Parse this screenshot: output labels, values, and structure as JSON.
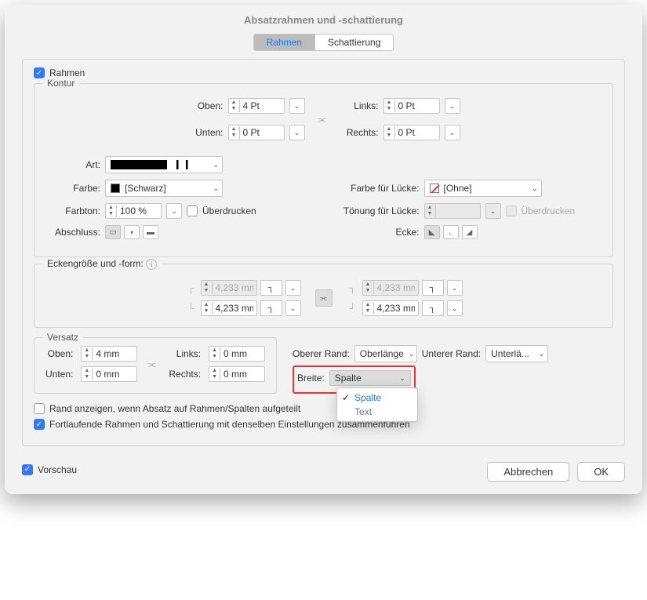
{
  "title": "Absatzrahmen und -schattierung",
  "tabs": {
    "rahmen": "Rahmen",
    "schattierung": "Schattierung"
  },
  "rahmen_chk": "Rahmen",
  "kontur": {
    "legend": "Kontur",
    "oben_l": "Oben:",
    "oben_v": "4 Pt",
    "unten_l": "Unten:",
    "unten_v": "0 Pt",
    "links_l": "Links:",
    "links_v": "0 Pt",
    "rechts_l": "Rechts:",
    "rechts_v": "0 Pt"
  },
  "art_l": "Art:",
  "farbe_l": "Farbe:",
  "farbe_v": "[Schwarz]",
  "farbton_l": "Farbton:",
  "farbton_v": "100 %",
  "ueberdrucken": "Überdrucken",
  "abschluss_l": "Abschluss:",
  "luecke_farbe_l": "Farbe für Lücke:",
  "luecke_farbe_v": "[Ohne]",
  "luecke_ton_l": "Tönung für Lücke:",
  "ecke_l": "Ecke:",
  "ecken_legend": "Eckengröße und -form:",
  "corner_v": "4,233 mm",
  "versatz": {
    "legend": "Versatz",
    "oben_l": "Oben:",
    "oben_v": "4 mm",
    "unten_l": "Unten:",
    "unten_v": "0 mm",
    "links_l": "Links:",
    "links_v": "0 mm",
    "rechts_l": "Rechts:",
    "rechts_v": "0 mm"
  },
  "oberer_rand_l": "Oberer Rand:",
  "oberer_rand_v": "Oberlänge",
  "unterer_rand_l": "Unterer Rand:",
  "unterer_rand_v": "Unterlä...",
  "breite_l": "Breite:",
  "breite_v": "Spalte",
  "breite_opts": {
    "spalte": "Spalte",
    "text": "Text"
  },
  "rand_anzeigen": "Rand anzeigen, wenn Absatz auf Rahmen/Spalten aufgeteilt",
  "fortlaufend": "Fortlaufende Rahmen und Schattierung mit denselben Einstellungen zusammenführen",
  "vorschau": "Vorschau",
  "abbrechen": "Abbrechen",
  "ok": "OK"
}
